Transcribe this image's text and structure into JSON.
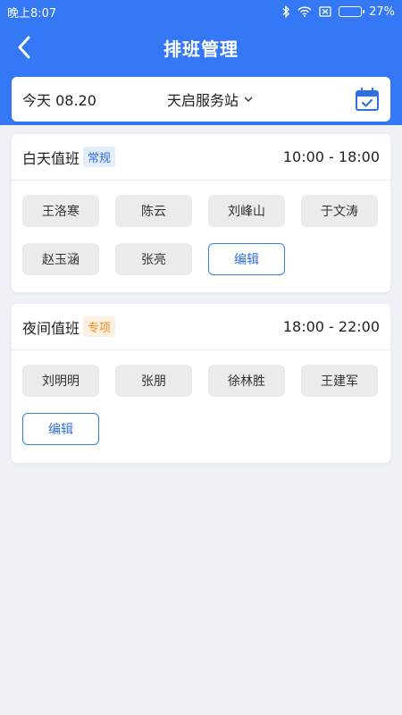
{
  "status_bar": {
    "time": "晚上8:07",
    "battery": "27%",
    "battery_level": 0.27
  },
  "nav": {
    "title": "排班管理",
    "back_icon": "chevron-left-icon"
  },
  "selector": {
    "date": "今天 08.20",
    "station": "天启服务站",
    "calendar_icon": "calendar-check-icon"
  },
  "shifts": [
    {
      "name": "白天值班",
      "tag": "常规",
      "time": "10:00 - 18:00",
      "staff": [
        "王洛寒",
        "陈云",
        "刘峰山",
        "于文涛",
        "赵玉涵",
        "张亮"
      ],
      "edit_label": "编辑"
    },
    {
      "name": "夜间值班",
      "tag": "专项",
      "time": "18:00 - 22:00",
      "staff": [
        "刘明明",
        "张朋",
        "徐林胜",
        "王建军"
      ],
      "edit_label": "编辑"
    }
  ],
  "colors": {
    "primary": "#3478f6",
    "tag_regular_text": "#2f6fde",
    "tag_special_text": "#f08a24"
  }
}
